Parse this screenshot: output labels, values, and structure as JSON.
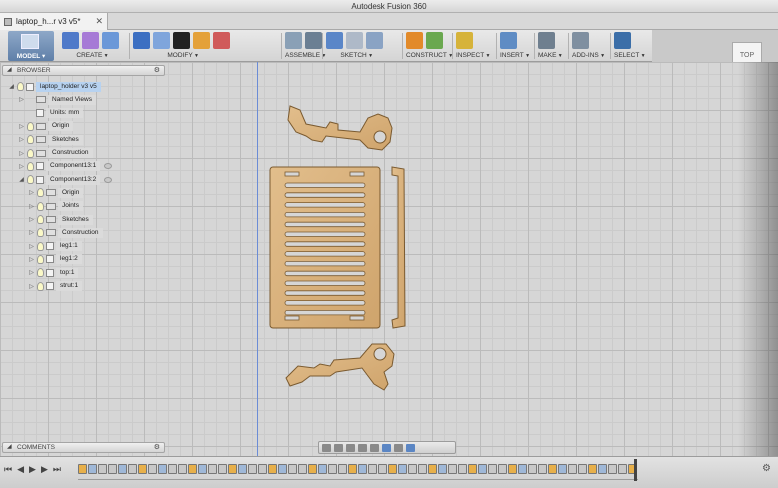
{
  "window": {
    "title": "Autodesk Fusion 360"
  },
  "tab": {
    "label": "laptop_h...r v3 v5*",
    "close": "✕"
  },
  "toolbar": {
    "workspace": "MODEL",
    "groups": [
      {
        "label": "CREATE",
        "icons": [
          "#4e79c9",
          "#a679d6",
          "#6b98d8"
        ]
      },
      {
        "label": "MODIFY",
        "icons": [
          "#3c6fc2",
          "#7fa5dc",
          "#222222",
          "#e4a13a",
          "#d05a5a"
        ]
      },
      {
        "label": "ASSEMBLE",
        "icons": [
          "#8aa0b6",
          "#6b7f93"
        ]
      },
      {
        "label": "SKETCH",
        "icons": [
          "#5a86c8",
          "#aeb9c8",
          "#8aa3c4"
        ]
      },
      {
        "label": "CONSTRUCT",
        "icons": [
          "#e28a2a",
          "#6aa84f"
        ]
      },
      {
        "label": "INSPECT",
        "icons": [
          "#d6b33a"
        ]
      },
      {
        "label": "INSERT",
        "icons": [
          "#5f8cc4"
        ]
      },
      {
        "label": "MAKE",
        "icons": [
          "#6f7f8f"
        ]
      },
      {
        "label": "ADD-INS",
        "icons": [
          "#7f8fa0"
        ]
      },
      {
        "label": "SELECT",
        "icons": [
          "#3b6ea8"
        ]
      }
    ]
  },
  "viewcube": {
    "label": "TOP"
  },
  "browser": {
    "title": "BROWSER",
    "items": [
      {
        "label": "laptop_holder v3 v5",
        "level": 0,
        "arrow": "down",
        "bulb": true,
        "icon": "comp",
        "highlight": true
      },
      {
        "label": "Named Views",
        "level": 1,
        "arrow": "right",
        "bulb": false,
        "icon": "folder"
      },
      {
        "label": "Units: mm",
        "level": 1,
        "arrow": "",
        "bulb": false,
        "icon": "comp"
      },
      {
        "label": "Origin",
        "level": 1,
        "arrow": "right",
        "bulb": true,
        "icon": "folder"
      },
      {
        "label": "Sketches",
        "level": 1,
        "arrow": "right",
        "bulb": true,
        "icon": "folder"
      },
      {
        "label": "Construction",
        "level": 1,
        "arrow": "right",
        "bulb": true,
        "icon": "folder"
      },
      {
        "label": "Component13:1",
        "level": 1,
        "arrow": "right",
        "bulb": true,
        "icon": "comp",
        "eye": true
      },
      {
        "label": "Component13:2",
        "level": 1,
        "arrow": "down",
        "bulb": true,
        "icon": "comp",
        "eye": true
      },
      {
        "label": "Origin",
        "level": 2,
        "arrow": "right",
        "bulb": true,
        "icon": "folder"
      },
      {
        "label": "Joints",
        "level": 2,
        "arrow": "right",
        "bulb": true,
        "icon": "folder"
      },
      {
        "label": "Sketches",
        "level": 2,
        "arrow": "right",
        "bulb": true,
        "icon": "folder"
      },
      {
        "label": "Construction",
        "level": 2,
        "arrow": "right",
        "bulb": true,
        "icon": "folder"
      },
      {
        "label": "leg1:1",
        "level": 2,
        "arrow": "right",
        "bulb": true,
        "icon": "comp"
      },
      {
        "label": "leg1:2",
        "level": 2,
        "arrow": "right",
        "bulb": true,
        "icon": "comp"
      },
      {
        "label": "top:1",
        "level": 2,
        "arrow": "right",
        "bulb": true,
        "icon": "comp"
      },
      {
        "label": "strut:1",
        "level": 2,
        "arrow": "right",
        "bulb": true,
        "icon": "comp"
      }
    ]
  },
  "comments": {
    "title": "COMMENTS"
  },
  "timeline": {
    "controls": [
      "⏮",
      "◀",
      "▶",
      "▶",
      "⏭"
    ],
    "item_colors": [
      "#e8b04a",
      "#9fb8d8",
      "#c8c8c8",
      "#c8c8c8",
      "#9fb8d8",
      "#c8c8c8",
      "#e8b04a",
      "#c8c8c8",
      "#9fb8d8",
      "#c8c8c8",
      "#c8c8c8",
      "#e8b04a",
      "#9fb8d8",
      "#c8c8c8",
      "#c8c8c8",
      "#e8b04a",
      "#9fb8d8",
      "#c8c8c8",
      "#c8c8c8",
      "#e8b04a",
      "#9fb8d8",
      "#c8c8c8",
      "#c8c8c8",
      "#e8b04a",
      "#9fb8d8",
      "#c8c8c8",
      "#c8c8c8",
      "#e8b04a",
      "#9fb8d8",
      "#c8c8c8",
      "#c8c8c8",
      "#e8b04a",
      "#9fb8d8",
      "#c8c8c8",
      "#c8c8c8",
      "#e8b04a",
      "#9fb8d8",
      "#c8c8c8",
      "#c8c8c8",
      "#e8b04a",
      "#9fb8d8",
      "#c8c8c8",
      "#c8c8c8",
      "#e8b04a",
      "#9fb8d8",
      "#c8c8c8",
      "#c8c8c8",
      "#e8b04a",
      "#9fb8d8",
      "#c8c8c8",
      "#c8c8c8",
      "#e8b04a",
      "#9fb8d8",
      "#c8c8c8",
      "#c8c8c8",
      "#e8b04a"
    ]
  },
  "colors": {
    "wood": "#dcb37d",
    "wood_edge": "#7a5a30",
    "axis": "#6b8cd6"
  }
}
